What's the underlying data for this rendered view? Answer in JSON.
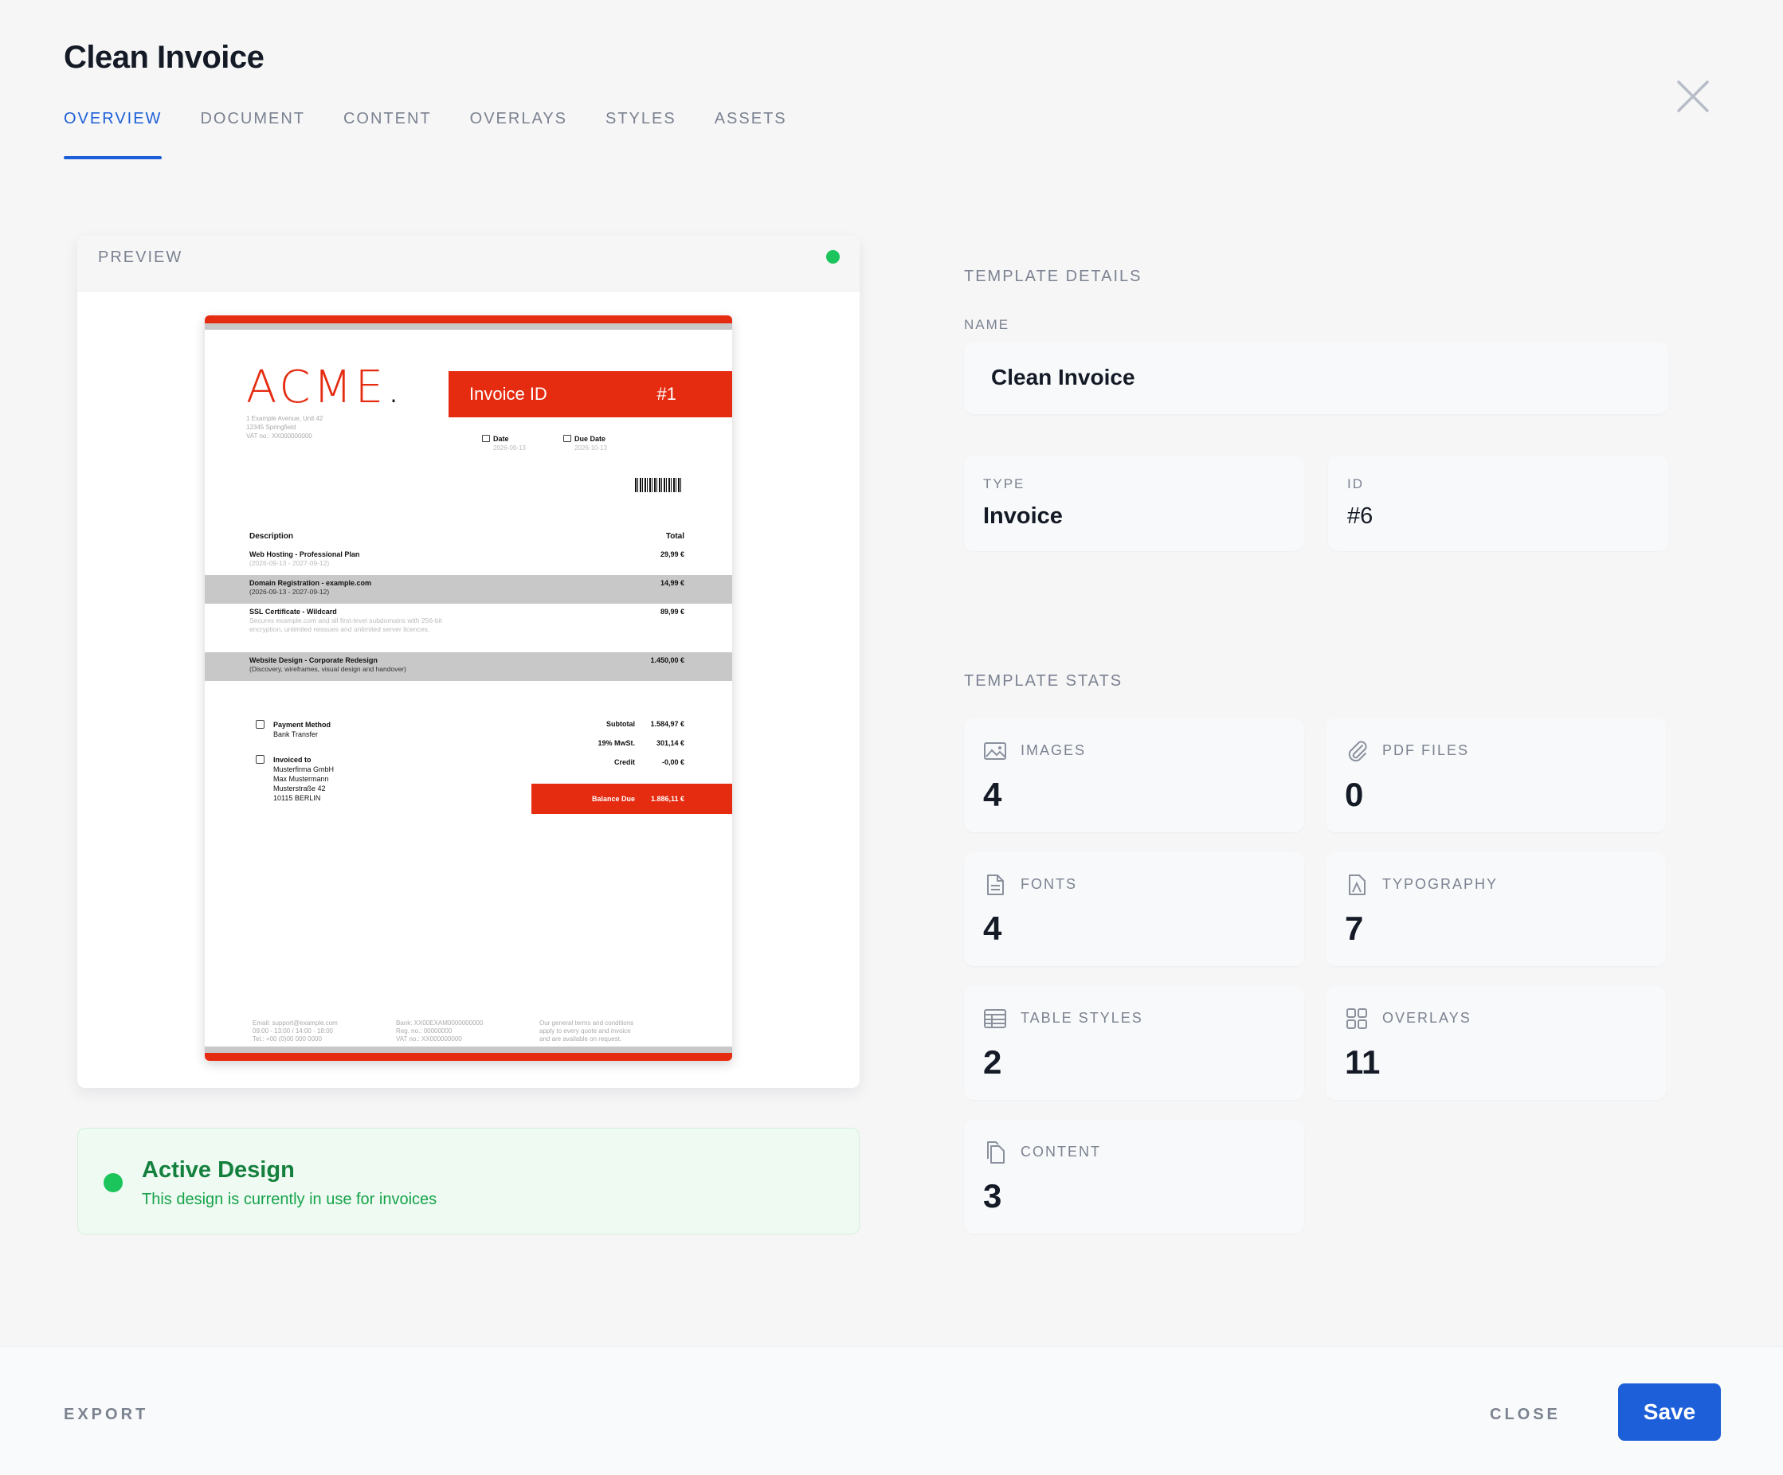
{
  "modal": {
    "title": "Clean Invoice"
  },
  "tabs": [
    {
      "label": "OVERVIEW",
      "active": true
    },
    {
      "label": "DOCUMENT"
    },
    {
      "label": "CONTENT"
    },
    {
      "label": "OVERLAYS"
    },
    {
      "label": "STYLES"
    },
    {
      "label": "ASSETS"
    }
  ],
  "preview": {
    "label": "PREVIEW",
    "invoice": {
      "logo": "ACME",
      "logo_dot": ".",
      "address": [
        "1 Example Avenue, Unit 42",
        "12345 Springfield",
        "VAT no.: XX000000000"
      ],
      "id_label": "Invoice ID",
      "id_value": "#1",
      "date_label": "Date",
      "date_value": "2026-09-13",
      "due_label": "Due Date",
      "due_value": "2026-10-13",
      "col_description": "Description",
      "col_total": "Total",
      "items": [
        {
          "desc": "Web Hosting - Professional Plan",
          "sub": "(2026-09-13 - 2027-09-12)",
          "total": "29,99 €"
        },
        {
          "desc": "Domain Registration - example.com",
          "sub": "(2026-09-13 - 2027-09-12)",
          "total": "14,99 €"
        },
        {
          "desc": "SSL Certificate - Wildcard",
          "sub": "Secures example.com and all first-level subdomains with 256-bit encryption, unlimited reissues and unlimited server licences.",
          "total": "89,99 €"
        },
        {
          "desc": "Website Design - Corporate Redesign",
          "sub": "(Discovery, wireframes, visual design and handover)",
          "total": "1.450,00 €"
        }
      ],
      "payment_label": "Payment Method",
      "payment_value": "Bank Transfer",
      "invoiced_label": "Invoiced to",
      "invoiced_lines": [
        "Musterfirma GmbH",
        "Max Mustermann",
        "Musterstraße 42",
        "10115 BERLIN"
      ],
      "subtotal_label": "Subtotal",
      "subtotal_value": "1.584,97 €",
      "tax_label": "19% MwSt.",
      "tax_value": "301,14 €",
      "credit_label": "Credit",
      "credit_value": "-0,00 €",
      "balance_label": "Balance Due",
      "balance_value": "1.886,11 €",
      "footer_col1": [
        "Email: support@example.com",
        "09:00 - 13:00 / 14:00 - 18:00",
        "Tel.: +00 (0)00 000 0000"
      ],
      "footer_col2": [
        "Bank: XX00EXAM0000000000",
        "Reg. no.: 00000000",
        "VAT no.: XX000000000"
      ],
      "footer_col3": [
        "Our general terms and conditions",
        "apply to every quote and invoice",
        "and are available on request."
      ]
    }
  },
  "active": {
    "title": "Active Design",
    "subtitle": "This design is currently in use for invoices"
  },
  "details": {
    "section": "TEMPLATE DETAILS",
    "name_label": "NAME",
    "name_value": "Clean Invoice",
    "type_label": "TYPE",
    "type_value": "Invoice",
    "id_label": "ID",
    "id_value": "#6"
  },
  "stats": {
    "section": "TEMPLATE STATS",
    "items": [
      {
        "label": "IMAGES",
        "value": "4",
        "icon": "image-icon"
      },
      {
        "label": "PDF FILES",
        "value": "0",
        "icon": "paperclip-icon"
      },
      {
        "label": "FONTS",
        "value": "4",
        "icon": "file-icon"
      },
      {
        "label": "TYPOGRAPHY",
        "value": "7",
        "icon": "typography-icon"
      },
      {
        "label": "TABLE STYLES",
        "value": "2",
        "icon": "table-icon"
      },
      {
        "label": "OVERLAYS",
        "value": "11",
        "icon": "grid-icon"
      },
      {
        "label": "CONTENT",
        "value": "3",
        "icon": "copy-icon"
      }
    ]
  },
  "footer": {
    "export_label": "EXPORT",
    "close_label": "CLOSE",
    "save_label": "Save"
  },
  "colors": {
    "accent": "#1d5fd8",
    "invoice_red": "#e52b10",
    "active_green": "#1cc45c",
    "active_text": "#15803d"
  }
}
